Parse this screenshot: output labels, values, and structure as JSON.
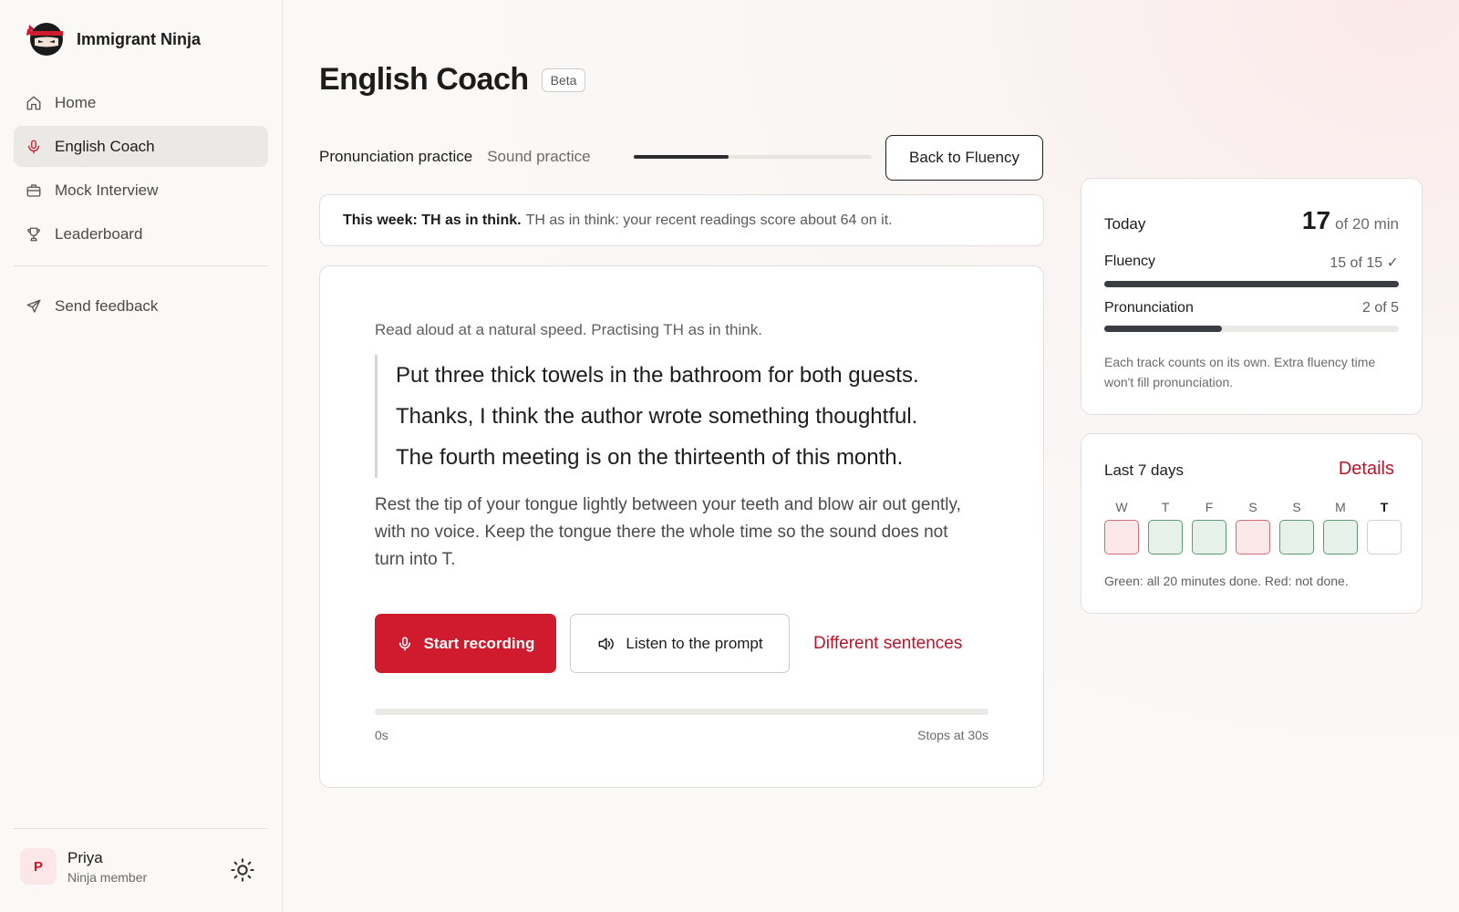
{
  "brand": {
    "name": "Immigrant Ninja"
  },
  "nav": [
    {
      "label": "Home",
      "icon": "home-icon",
      "active": false
    },
    {
      "label": "English Coach",
      "icon": "microphone-icon",
      "active": true
    },
    {
      "label": "Mock Interview",
      "icon": "briefcase-icon",
      "active": false
    },
    {
      "label": "Leaderboard",
      "icon": "trophy-icon",
      "active": false
    }
  ],
  "feedback": {
    "label": "Send feedback",
    "icon": "send-icon"
  },
  "user": {
    "initial": "P",
    "name": "Priya",
    "role": "Ninja member"
  },
  "header": {
    "title": "English Coach",
    "badge": "Beta"
  },
  "tabs": {
    "active": "Pronunciation practice",
    "inactive": "Sound practice",
    "progress_fraction": 0.4,
    "back_label": "Back to Fluency"
  },
  "week_banner": {
    "strong": "This week: TH as in think.",
    "rest": "TH as in think: your recent readings score about 64 on it."
  },
  "practice": {
    "instruction": "Read aloud at a natural speed. Practising TH as in think.",
    "sentences": [
      "Put three thick towels in the bathroom for both guests.",
      "Thanks, I think the author wrote something thoughtful.",
      "The fourth meeting is on the thirteenth of this month."
    ],
    "tip": "Rest the tip of your tongue lightly between your teeth and blow air out gently, with no voice. Keep the tongue there the whole time so the sound does not turn into T.",
    "record_label": "Start recording",
    "listen_label": "Listen to the prompt",
    "different_label": "Different sentences",
    "timer_start": "0s",
    "timer_end": "Stops at 30s"
  },
  "today": {
    "label": "Today",
    "minutes": "17",
    "of_total": "of 20 min",
    "fluency": {
      "name": "Fluency",
      "value": "15 of 15 ✓",
      "fraction": 1.0
    },
    "pronunciation": {
      "name": "Pronunciation",
      "value": "2 of 5",
      "fraction": 0.4
    },
    "note": "Each track counts on its own. Extra fluency time won't fill pronunciation."
  },
  "last7": {
    "label": "Last 7 days",
    "details_label": "Details",
    "days": [
      {
        "letter": "W",
        "status": "not-done"
      },
      {
        "letter": "T",
        "status": "done"
      },
      {
        "letter": "F",
        "status": "done"
      },
      {
        "letter": "S",
        "status": "not-done"
      },
      {
        "letter": "S",
        "status": "done"
      },
      {
        "letter": "M",
        "status": "done"
      },
      {
        "letter": "T",
        "status": "today"
      }
    ],
    "note": "Green: all 20 minutes done. Red: not done."
  },
  "colors": {
    "accent": "#d01a2e",
    "link": "#b8152a",
    "done_bg": "#e6f1ea",
    "done_border": "#5f9a72",
    "notdone_bg": "#fbe9ea",
    "notdone_border": "#d36b76"
  }
}
